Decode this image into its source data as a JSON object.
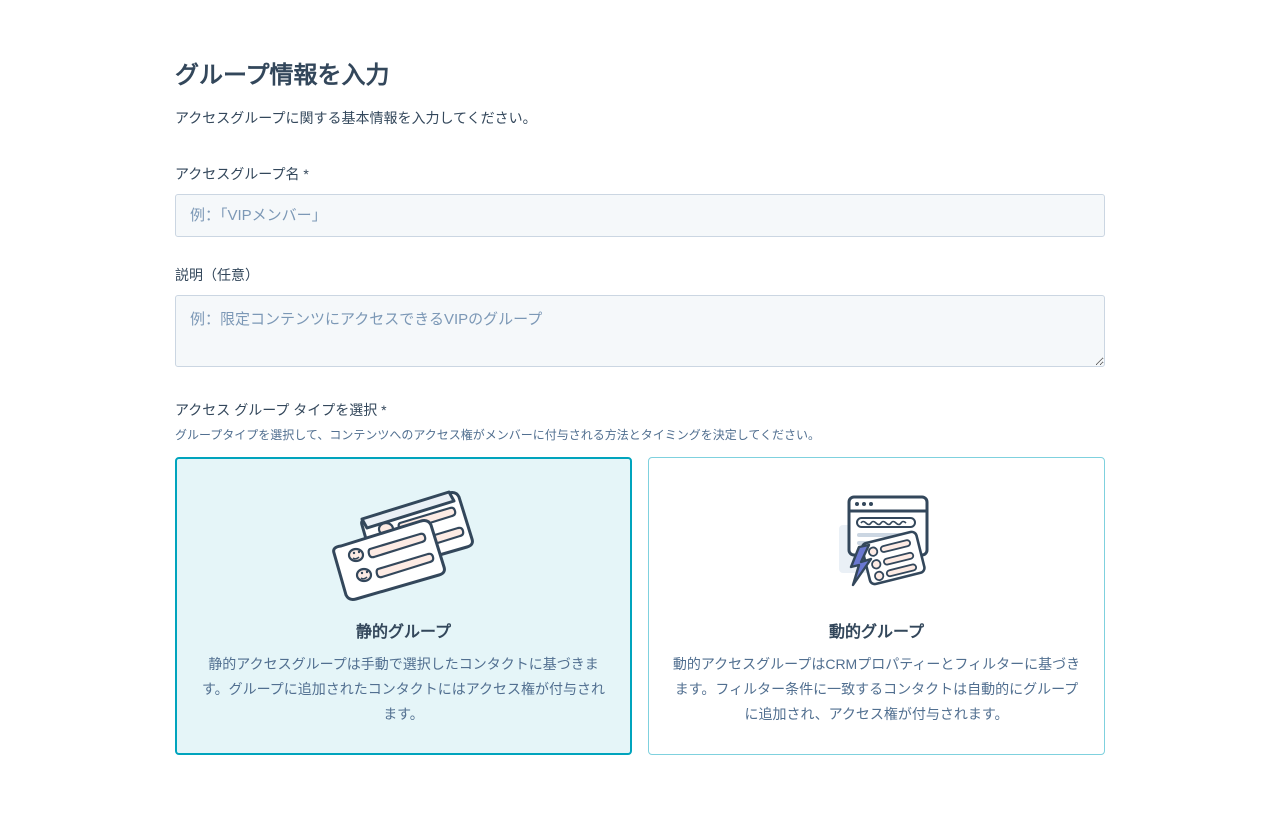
{
  "title": "グループ情報を入力",
  "subtitle": "アクセスグループに関する基本情報を入力してください。",
  "fields": {
    "name": {
      "label": "アクセスグループ名 *",
      "placeholder": "例：「VIPメンバー」"
    },
    "description": {
      "label": "説明（任意）",
      "placeholder": "例：限定コンテンツにアクセスできるVIPのグループ"
    }
  },
  "typeSection": {
    "label": "アクセス グループ タイプを選択 *",
    "help": "グループタイプを選択して、コンテンツへのアクセス権がメンバーに付与される方法とタイミングを決定してください。"
  },
  "cards": {
    "static": {
      "title": "静的グループ",
      "description": "静的アクセスグループは手動で選択したコンタクトに基づきます。グループに追加されたコンタクトにはアクセス権が付与されます。"
    },
    "dynamic": {
      "title": "動的グループ",
      "description": "動的アクセスグループはCRMプロパティーとフィルターに基づきます。フィルター条件に一致するコンタクトは自動的にグループに追加され、アクセス権が付与されます。"
    }
  }
}
